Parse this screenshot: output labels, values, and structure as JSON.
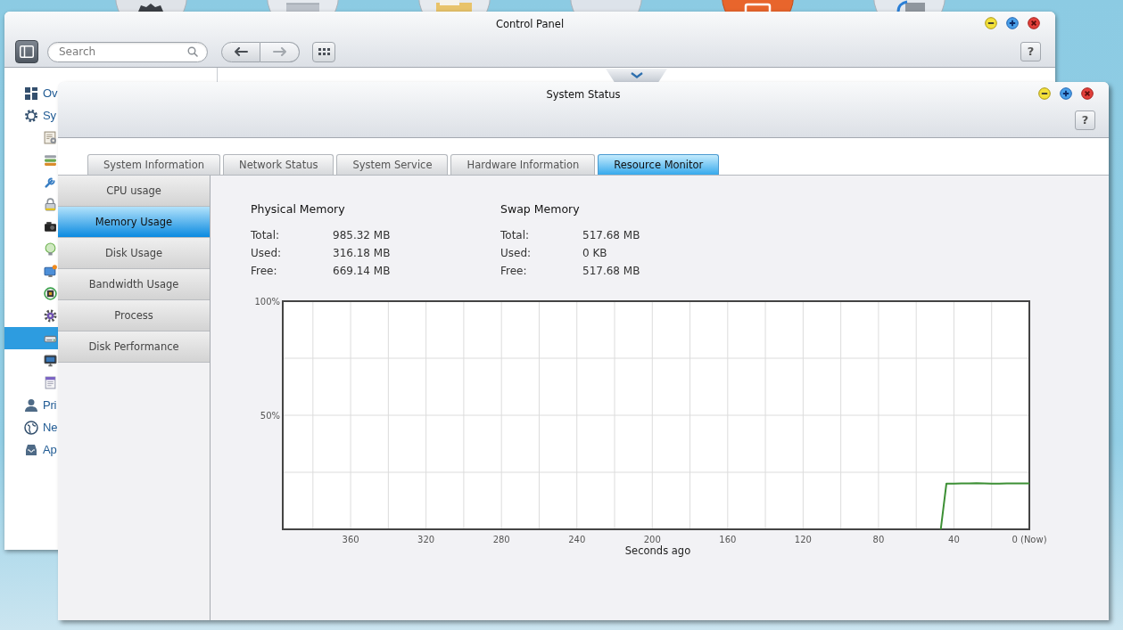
{
  "control_panel": {
    "title": "Control Panel",
    "search": {
      "placeholder": "Search"
    },
    "nav_buttons": [
      {
        "kind": "back",
        "disabled": false
      },
      {
        "kind": "forward",
        "disabled": true
      }
    ],
    "help": "?",
    "sidebar": {
      "items": [
        {
          "label": "Ov",
          "selected": false
        },
        {
          "label": "Sy",
          "selected": false,
          "children": [
            {
              "selected": false
            },
            {
              "selected": false
            },
            {
              "selected": false
            },
            {
              "selected": false
            },
            {
              "selected": false
            },
            {
              "selected": false
            },
            {
              "selected": false
            },
            {
              "selected": false
            },
            {
              "selected": false
            },
            {
              "selected": true
            },
            {
              "selected": false
            },
            {
              "selected": false
            }
          ]
        },
        {
          "label": "Pri",
          "selected": false
        },
        {
          "label": "Ne",
          "selected": false
        },
        {
          "label": "Ap",
          "selected": false
        }
      ]
    }
  },
  "system_status": {
    "title": "System Status",
    "help": "?",
    "tabs": [
      {
        "label": "System Information",
        "selected": false
      },
      {
        "label": "Network Status",
        "selected": false
      },
      {
        "label": "System Service",
        "selected": false
      },
      {
        "label": "Hardware Information",
        "selected": false
      },
      {
        "label": "Resource Monitor",
        "selected": true
      }
    ],
    "nav": [
      {
        "label": "CPU usage",
        "selected": false
      },
      {
        "label": "Memory Usage",
        "selected": true
      },
      {
        "label": "Disk Usage",
        "selected": false
      },
      {
        "label": "Bandwidth Usage",
        "selected": false
      },
      {
        "label": "Process",
        "selected": false
      },
      {
        "label": "Disk Performance",
        "selected": false
      }
    ],
    "memory": [
      {
        "heading": "Physical Memory",
        "rows": [
          {
            "label": "Total:",
            "value": "985.32 MB"
          },
          {
            "label": "Used:",
            "value": "316.18 MB"
          },
          {
            "label": "Free:",
            "value": "669.14 MB"
          }
        ]
      },
      {
        "heading": "Swap Memory",
        "rows": [
          {
            "label": "Total:",
            "value": "517.68 MB"
          },
          {
            "label": "Used:",
            "value": "0 KB"
          },
          {
            "label": "Free:",
            "value": "517.68 MB"
          }
        ]
      }
    ],
    "chart_data": {
      "type": "line",
      "xlabel": "Seconds ago",
      "x": [
        47,
        44,
        40,
        36,
        32,
        28,
        24,
        20,
        16,
        12,
        8,
        4,
        0
      ],
      "values": [
        0,
        20.0,
        20.0,
        20.1,
        20.1,
        20.2,
        20.1,
        20.0,
        20.0,
        20.1,
        20.1,
        20.1,
        20.1
      ],
      "xlim": [
        396,
        0
      ],
      "ylim": [
        0,
        100
      ],
      "xticks": [
        360,
        320,
        280,
        240,
        200,
        160,
        120,
        80,
        40,
        {
          "value": 0,
          "label": "0 (Now)"
        }
      ],
      "yticks": [
        {
          "value": 50,
          "label": "50%"
        },
        {
          "value": 100,
          "label": "100%"
        }
      ],
      "grid": true
    }
  }
}
